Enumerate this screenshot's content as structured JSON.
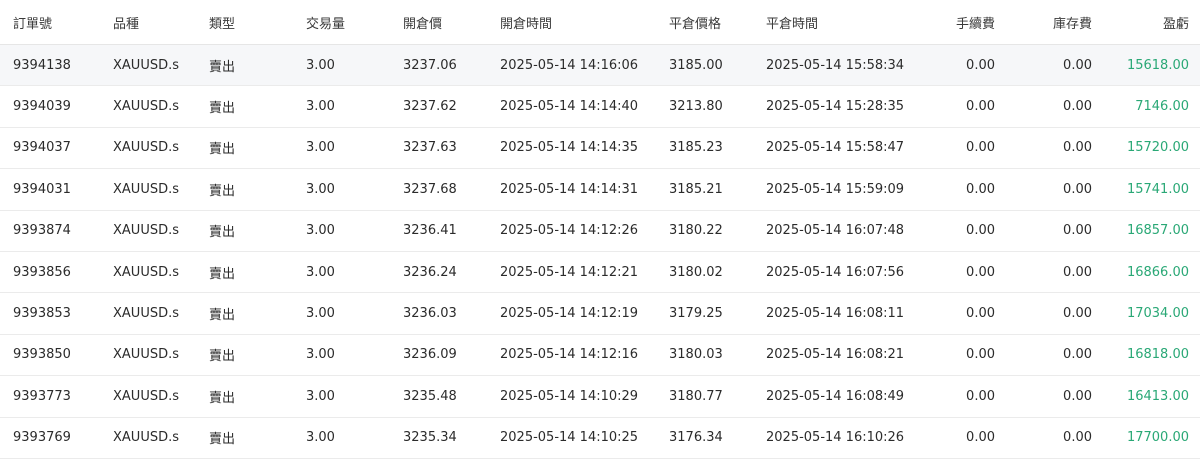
{
  "columns": {
    "order": "訂單號",
    "symbol": "品種",
    "type": "類型",
    "volume": "交易量",
    "open_price": "開倉價",
    "open_time": "開倉時間",
    "close_price": "平倉價格",
    "close_time": "平倉時間",
    "fee": "手續費",
    "swap": "庫存費",
    "profit": "盈虧"
  },
  "rows": [
    {
      "order": "9394138",
      "symbol": "XAUUSD.s",
      "type": "賣出",
      "volume": "3.00",
      "open_price": "3237.06",
      "open_time": "2025-05-14 14:16:06",
      "close_price": "3185.00",
      "close_time": "2025-05-14 15:58:34",
      "fee": "0.00",
      "swap": "0.00",
      "profit": "15618.00"
    },
    {
      "order": "9394039",
      "symbol": "XAUUSD.s",
      "type": "賣出",
      "volume": "3.00",
      "open_price": "3237.62",
      "open_time": "2025-05-14 14:14:40",
      "close_price": "3213.80",
      "close_time": "2025-05-14 15:28:35",
      "fee": "0.00",
      "swap": "0.00",
      "profit": "7146.00"
    },
    {
      "order": "9394037",
      "symbol": "XAUUSD.s",
      "type": "賣出",
      "volume": "3.00",
      "open_price": "3237.63",
      "open_time": "2025-05-14 14:14:35",
      "close_price": "3185.23",
      "close_time": "2025-05-14 15:58:47",
      "fee": "0.00",
      "swap": "0.00",
      "profit": "15720.00"
    },
    {
      "order": "9394031",
      "symbol": "XAUUSD.s",
      "type": "賣出",
      "volume": "3.00",
      "open_price": "3237.68",
      "open_time": "2025-05-14 14:14:31",
      "close_price": "3185.21",
      "close_time": "2025-05-14 15:59:09",
      "fee": "0.00",
      "swap": "0.00",
      "profit": "15741.00"
    },
    {
      "order": "9393874",
      "symbol": "XAUUSD.s",
      "type": "賣出",
      "volume": "3.00",
      "open_price": "3236.41",
      "open_time": "2025-05-14 14:12:26",
      "close_price": "3180.22",
      "close_time": "2025-05-14 16:07:48",
      "fee": "0.00",
      "swap": "0.00",
      "profit": "16857.00"
    },
    {
      "order": "9393856",
      "symbol": "XAUUSD.s",
      "type": "賣出",
      "volume": "3.00",
      "open_price": "3236.24",
      "open_time": "2025-05-14 14:12:21",
      "close_price": "3180.02",
      "close_time": "2025-05-14 16:07:56",
      "fee": "0.00",
      "swap": "0.00",
      "profit": "16866.00"
    },
    {
      "order": "9393853",
      "symbol": "XAUUSD.s",
      "type": "賣出",
      "volume": "3.00",
      "open_price": "3236.03",
      "open_time": "2025-05-14 14:12:19",
      "close_price": "3179.25",
      "close_time": "2025-05-14 16:08:11",
      "fee": "0.00",
      "swap": "0.00",
      "profit": "17034.00"
    },
    {
      "order": "9393850",
      "symbol": "XAUUSD.s",
      "type": "賣出",
      "volume": "3.00",
      "open_price": "3236.09",
      "open_time": "2025-05-14 14:12:16",
      "close_price": "3180.03",
      "close_time": "2025-05-14 16:08:21",
      "fee": "0.00",
      "swap": "0.00",
      "profit": "16818.00"
    },
    {
      "order": "9393773",
      "symbol": "XAUUSD.s",
      "type": "賣出",
      "volume": "3.00",
      "open_price": "3235.48",
      "open_time": "2025-05-14 14:10:29",
      "close_price": "3180.77",
      "close_time": "2025-05-14 16:08:49",
      "fee": "0.00",
      "swap": "0.00",
      "profit": "16413.00"
    },
    {
      "order": "9393769",
      "symbol": "XAUUSD.s",
      "type": "賣出",
      "volume": "3.00",
      "open_price": "3235.34",
      "open_time": "2025-05-14 14:10:25",
      "close_price": "3176.34",
      "close_time": "2025-05-14 16:10:26",
      "fee": "0.00",
      "swap": "0.00",
      "profit": "17700.00"
    }
  ],
  "colors": {
    "profit": "#2aa876",
    "highlight_row": "#f6f7f9"
  }
}
